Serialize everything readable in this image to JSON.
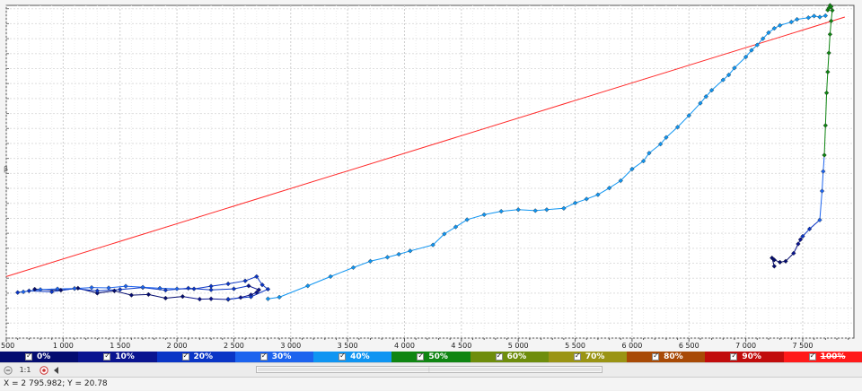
{
  "chart_data": {
    "type": "scatter",
    "title": "",
    "xlabel": "",
    "ylabel": "",
    "xlim": [
      500,
      7950
    ],
    "ylim": [
      0,
      100
    ],
    "x_ticks": [
      1000,
      1500,
      2000,
      2500,
      3000,
      3500,
      4000,
      4500,
      5000,
      5500,
      6000,
      6500,
      7000,
      7500
    ],
    "x_tick_labels": [
      "1 000",
      "1 500",
      "2 000",
      "2 500",
      "3 000",
      "3 500",
      "4 000",
      "4 500",
      "5 000",
      "5 500",
      "6 000",
      "6 500",
      "7 000",
      "7 500"
    ],
    "y_axis_labels": [],
    "first_x_tick_label": "500",
    "grid": true,
    "reference_line": {
      "color": "#ff2a2a",
      "x": [
        500,
        7870
      ],
      "y": [
        18.5,
        96.5
      ]
    },
    "series": [
      {
        "color_by": "percent",
        "x": [
          750,
          980,
          1130,
          1300,
          1450,
          1600,
          1750,
          1900,
          2050,
          2200,
          2300,
          2450,
          2560,
          2650,
          2700,
          2720,
          2630,
          2500,
          2300,
          2100,
          1900,
          1700,
          1500,
          1300,
          1100,
          900,
          700,
          600,
          650,
          800,
          950,
          1100,
          1250,
          1400,
          1550,
          1700,
          1850,
          2000,
          2150,
          2300,
          2450,
          2600,
          2700,
          2750,
          2800,
          2650,
          2450
        ],
        "y": [
          14.7,
          14.4,
          15.0,
          13.5,
          14.2,
          12.9,
          13.1,
          12.0,
          12.5,
          11.7,
          11.8,
          11.6,
          12.2,
          13.0,
          13.7,
          14.5,
          15.7,
          14.8,
          14.5,
          15.0,
          14.4,
          15.2,
          14.6,
          14.2,
          14.9,
          13.9,
          14.2,
          13.7,
          13.9,
          14.6,
          14.8,
          14.9,
          15.2,
          15.1,
          15.6,
          15.3,
          15.0,
          14.8,
          14.8,
          15.6,
          16.3,
          17.2,
          18.5,
          16.0,
          14.7,
          12.4,
          11.7
        ],
        "percent": [
          0,
          0,
          0,
          0,
          0,
          0,
          0,
          0,
          0,
          10,
          10,
          10,
          10,
          10,
          10,
          10,
          10,
          20,
          20,
          20,
          20,
          20,
          20,
          20,
          20,
          20,
          20,
          20,
          30,
          30,
          30,
          30,
          30,
          30,
          30,
          30,
          30,
          30,
          20,
          20,
          20,
          20,
          20,
          20,
          20,
          20,
          20
        ]
      },
      {
        "color_by": "percent",
        "x": [
          2800,
          2900,
          3150,
          3350,
          3550,
          3700,
          3850,
          3950,
          4050,
          4250,
          4350,
          4450,
          4550,
          4700,
          4850,
          5000,
          5150,
          5250,
          5400,
          5500,
          5600,
          5700,
          5800,
          5900,
          6000,
          6100,
          6150,
          6250,
          6300,
          6400,
          6500,
          6600,
          6650,
          6700,
          6800,
          6850,
          6900,
          7000,
          7050,
          7100,
          7150,
          7200,
          7250,
          7300,
          7400,
          7450,
          7550,
          7600,
          7650,
          7700
        ],
        "y": [
          11.8,
          12.3,
          15.7,
          18.5,
          21.2,
          23.1,
          24.3,
          25.2,
          26.2,
          28.0,
          31.3,
          33.4,
          35.6,
          37.1,
          38.1,
          38.6,
          38.3,
          38.6,
          39.0,
          40.6,
          41.8,
          43.1,
          45.1,
          47.3,
          50.8,
          53.2,
          55.6,
          58.3,
          60.3,
          63.4,
          66.9,
          70.6,
          72.6,
          74.5,
          77.6,
          79.1,
          81.2,
          84.5,
          86.5,
          88.1,
          90.0,
          91.8,
          93.1,
          94.0,
          95.0,
          95.8,
          96.3,
          96.8,
          96.5,
          96.9
        ],
        "percent": [
          40,
          40,
          40,
          40,
          40,
          40,
          40,
          40,
          40,
          40,
          40,
          40,
          40,
          40,
          40,
          40,
          40,
          40,
          40,
          40,
          40,
          40,
          40,
          40,
          40,
          40,
          40,
          40,
          40,
          40,
          40,
          40,
          40,
          40,
          40,
          40,
          40,
          40,
          40,
          40,
          40,
          40,
          40,
          40,
          40,
          40,
          40,
          40,
          40,
          40
        ]
      },
      {
        "color_by": "percent",
        "x": [
          7720,
          7730,
          7740,
          7750,
          7760,
          7750,
          7740,
          7730,
          7720,
          7710,
          7700,
          7690,
          7680,
          7670,
          7650,
          7560,
          7500,
          7480,
          7460,
          7420,
          7350,
          7300,
          7250,
          7230,
          7250
        ],
        "y": [
          98.6,
          99.2,
          100.0,
          99.6,
          98.5,
          95.3,
          91.3,
          85.7,
          80.0,
          73.7,
          63.9,
          55.0,
          50.1,
          44.2,
          35.5,
          32.8,
          30.6,
          29.6,
          28.3,
          25.5,
          23.1,
          22.8,
          23.5,
          24.1,
          21.6
        ],
        "percent": [
          50,
          50,
          50,
          50,
          50,
          50,
          50,
          50,
          50,
          50,
          50,
          50,
          30,
          30,
          30,
          20,
          20,
          10,
          10,
          10,
          0,
          0,
          0,
          0,
          0
        ]
      }
    ],
    "legend": [
      "0%",
      "10%",
      "20%",
      "30%",
      "40%",
      "50%",
      "60%",
      "70%",
      "80%",
      "90%",
      "100%"
    ],
    "legend_colors": [
      "#040c70",
      "#0a1490",
      "#0a35c6",
      "#1c63ee",
      "#0f95f2",
      "#0f8512",
      "#6e8d0c",
      "#9a9414",
      "#a84a06",
      "#c10c0c",
      "#ff1a1a"
    ]
  },
  "toolbar": {
    "zoom_label": "1:1"
  },
  "status": {
    "text": "X = 2 795.982; Y = 20.78"
  },
  "y_axis_marker": "β"
}
